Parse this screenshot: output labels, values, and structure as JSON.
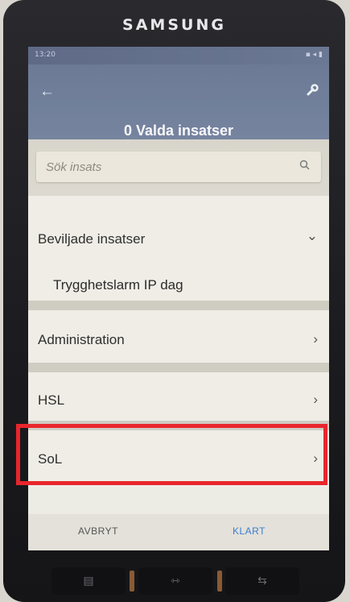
{
  "device": {
    "brand": "SAMSUNG"
  },
  "status_bar": {
    "time": "13:20",
    "icons": "▪ ◂ ▮"
  },
  "header": {
    "title": "0 Valda insatser",
    "back_icon": "arrow-left",
    "action_icon": "wrench"
  },
  "search": {
    "placeholder": "Sök insats"
  },
  "sections": [
    {
      "label": "Beviljade insatser",
      "expanded": true,
      "items": [
        "Trygghetslarm IP dag"
      ]
    },
    {
      "label": "Administration",
      "expanded": false
    },
    {
      "label": "HSL",
      "expanded": false
    },
    {
      "label": "SoL",
      "expanded": false,
      "highlighted": true
    }
  ],
  "footer": {
    "cancel_label": "AVBRYT",
    "done_label": "KLART"
  },
  "hardware_keys": [
    "recent-apps",
    "home",
    "back"
  ],
  "colors": {
    "appbar": "#6d7a96",
    "highlight": "#e8262c",
    "done": "#3b7dd8"
  }
}
